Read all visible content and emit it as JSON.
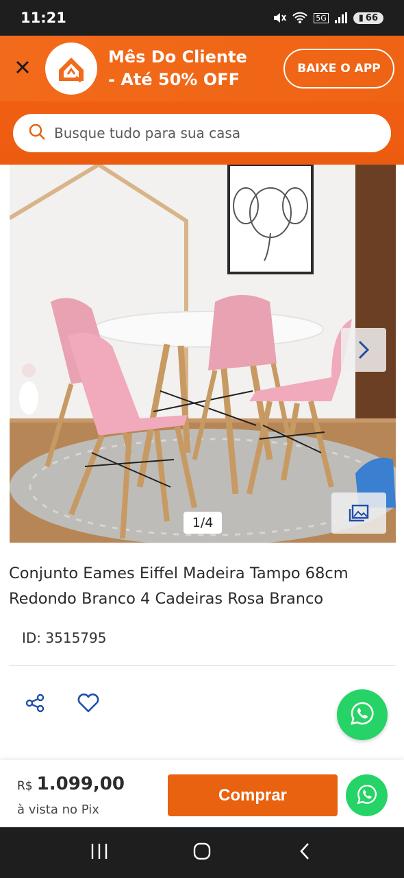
{
  "status_bar": {
    "time": "11:21",
    "network": "5G",
    "battery": "66"
  },
  "promo": {
    "line1": "Mês Do Cliente",
    "line2": "- Até 50% OFF",
    "cta": "BAIXE O APP"
  },
  "search": {
    "placeholder": "Busque tudo para sua casa"
  },
  "gallery": {
    "counter": "1/4"
  },
  "product": {
    "title": "Conjunto Eames Eiffel Madeira Tampo 68cm Redondo Branco 4 Cadeiras Rosa Branco",
    "id": "ID: 3515795"
  },
  "purchase": {
    "currency": "R$",
    "price": "1.099,00",
    "note": "à vista no Pix",
    "buy_label": "Comprar"
  },
  "colors": {
    "brand_orange": "#ef6414",
    "whatsapp_green": "#25d366",
    "icon_blue": "#1f4fa8"
  }
}
